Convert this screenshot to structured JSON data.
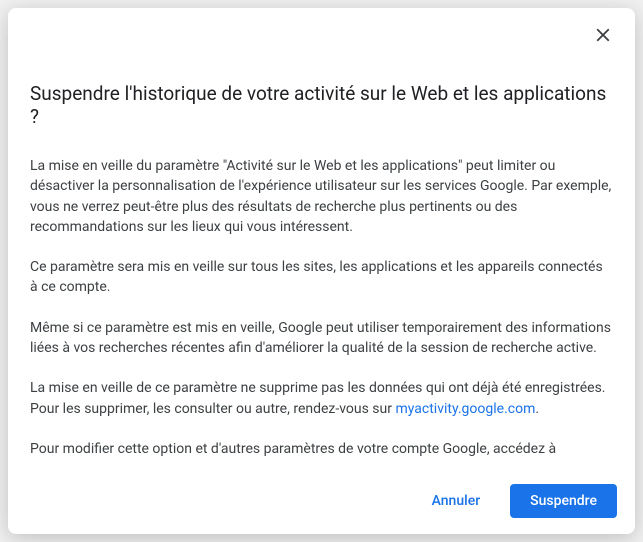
{
  "dialog": {
    "title": "Suspendre l'historique de votre activité sur le Web et les applications ?",
    "paragraphs": {
      "p1": "La mise en veille du paramètre \"Activité sur le Web et les applications\" peut limiter ou désactiver la personnalisation de l'expérience utilisateur sur les services Google. Par exemple, vous ne verrez peut-être plus des résultats de recherche plus pertinents ou des recommandations sur les lieux qui vous intéressent.",
      "p2": "Ce paramètre sera mis en veille sur tous les sites, les applications et les appareils connectés à ce compte.",
      "p3": "Même si ce paramètre est mis en veille, Google peut utiliser temporairement des informations liées à vos recherches récentes afin d'améliorer la qualité de la session de recherche active.",
      "p4_prefix": "La mise en veille de ce paramètre ne supprime pas les données qui ont déjà été enregistrées. Pour les supprimer, les consulter ou autre, rendez-vous sur ",
      "p4_link_text": "myactivity.google.com",
      "p4_suffix": ".",
      "p5": "Pour modifier cette option et d'autres paramètres de votre compte Google, accédez à"
    },
    "link_url": "myactivity.google.com",
    "buttons": {
      "cancel": "Annuler",
      "confirm": "Suspendre"
    },
    "colors": {
      "primary": "#1a73e8",
      "text": "#3c4043",
      "heading": "#202124"
    }
  }
}
